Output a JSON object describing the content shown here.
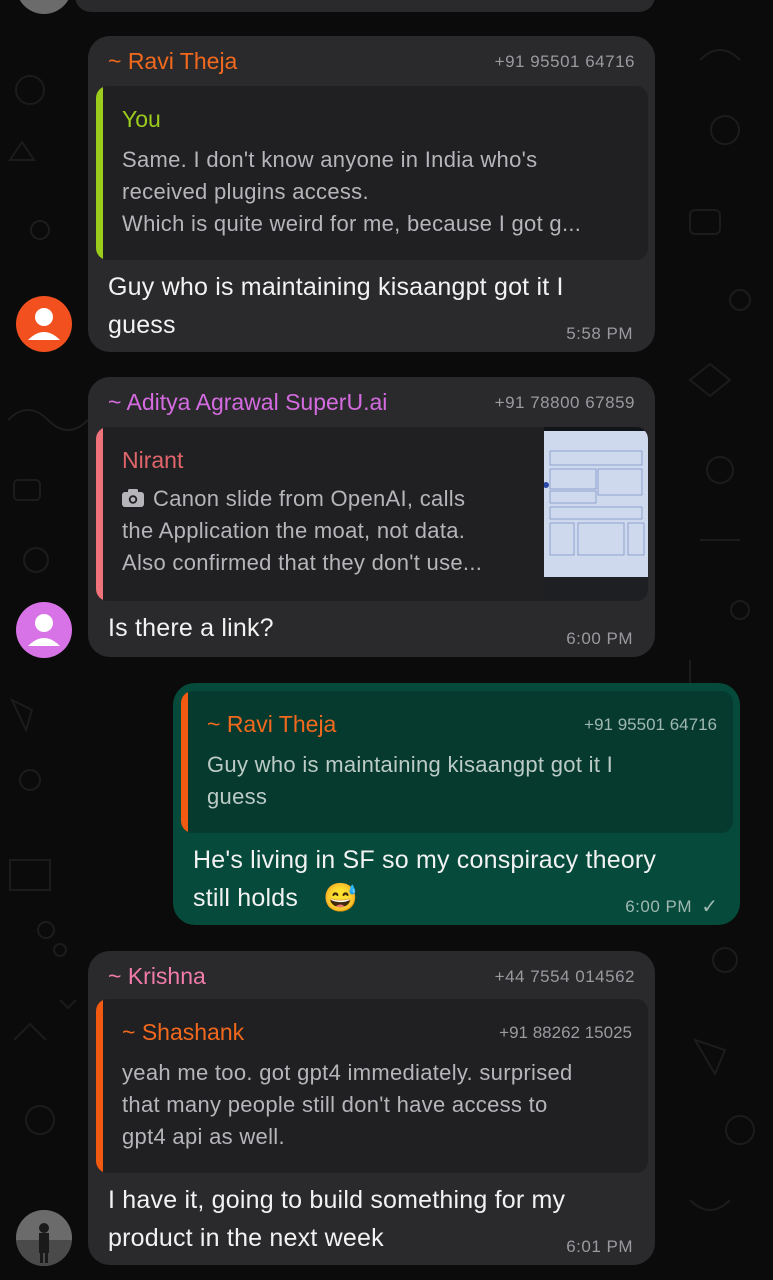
{
  "colors": {
    "background": "#0b0b0b",
    "incoming_bubble": "#2a2a2c",
    "outgoing_bubble": "#054a3b",
    "quote_bg": "#202022",
    "ravi_name": "#f2691e",
    "aditya_name": "#d46be0",
    "krishna_name": "#f07ca8",
    "you_name": "#9ccc1c",
    "nirant_name": "#e0656b",
    "shashank_name": "#f2691e",
    "bar_you": "#9ccc1c",
    "bar_nirant": "#f0727a",
    "bar_orange": "#f25a12"
  },
  "messages": [
    {
      "sender": "~ Ravi Theja",
      "phone": "+91 95501 64716",
      "avatar_icon": "person-icon",
      "avatar_color": "#f2501f",
      "quote": {
        "name": "You",
        "lines": [
          "Same. I don't know anyone in India who's",
          "received plugins access.",
          "Which is quite weird for me, because I got g..."
        ]
      },
      "text_lines": [
        "Guy who is maintaining kisaangpt got it I",
        "guess"
      ],
      "time": "5:58 PM"
    },
    {
      "sender": "~ Aditya Agrawal SuperU.ai",
      "phone": "+91 78800 67859",
      "avatar_icon": "person-icon",
      "avatar_color": "#d773e6",
      "quote": {
        "name": "Nirant",
        "camera_icon": "camera-icon",
        "lines": [
          "Canon slide from OpenAI, calls",
          "the Application the moat, not data.",
          "Also confirmed that they don't use..."
        ],
        "thumbnail": "slide-thumbnail"
      },
      "text_lines": [
        "Is there a link?"
      ],
      "time": "6:00 PM"
    },
    {
      "outgoing": true,
      "quote": {
        "name": "~ Ravi Theja",
        "phone": "+91 95501 64716",
        "lines": [
          "Guy who is maintaining kisaangpt got it I",
          "guess"
        ]
      },
      "text_lines": [
        "He's living in SF so my conspiracy theory",
        "still holds"
      ],
      "emoji": "😅",
      "time": "6:00 PM",
      "status": "✓"
    },
    {
      "sender": "~ Krishna",
      "phone": "+44 7554 014562",
      "avatar_icon": "photo-avatar",
      "quote": {
        "name": "~ Shashank",
        "phone": "+91 88262 15025",
        "lines": [
          "yeah me too. got gpt4 immediately. surprised",
          "that many people still don't have access to",
          "gpt4 api as well."
        ]
      },
      "text_lines": [
        "I have it, going to build something for my",
        "product in the next week"
      ],
      "time": "6:01 PM"
    }
  ]
}
